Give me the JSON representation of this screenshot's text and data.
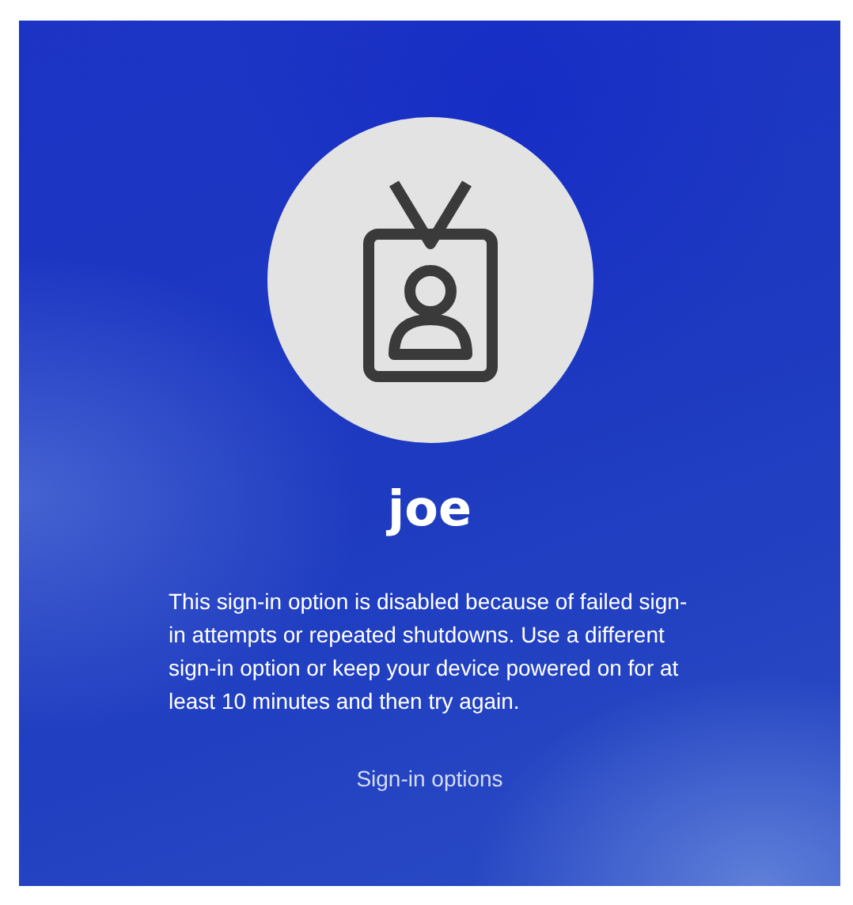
{
  "user": {
    "name": "joe"
  },
  "message": "This sign-in option is disabled because of failed sign-in attempts or repeated shutdowns. Use a different sign-in option or keep your device powered on for at least 10 minutes and then try again.",
  "link": "Sign-in options"
}
